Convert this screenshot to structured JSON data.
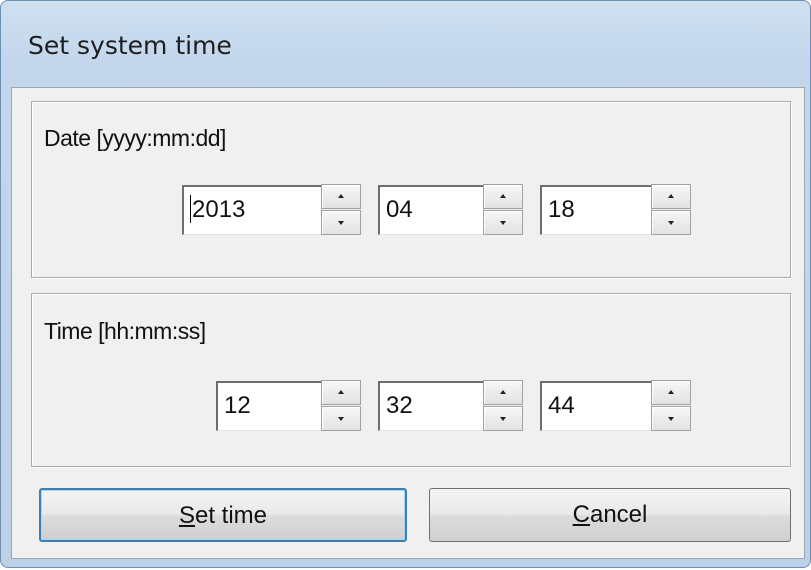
{
  "window": {
    "title": "Set system time"
  },
  "date_group": {
    "label": "Date [yyyy:mm:dd]",
    "year": "2013",
    "month": "04",
    "day": "18"
  },
  "time_group": {
    "label": "Time [hh:mm:ss]",
    "hour": "12",
    "minute": "32",
    "second": "44"
  },
  "buttons": {
    "set_time": {
      "mnemonic": "S",
      "rest": "et time"
    },
    "cancel": {
      "mnemonic": "C",
      "rest": "ancel"
    }
  },
  "icons": {
    "spin_up": "spin-up-arrow-icon",
    "spin_down": "spin-down-arrow-icon"
  }
}
